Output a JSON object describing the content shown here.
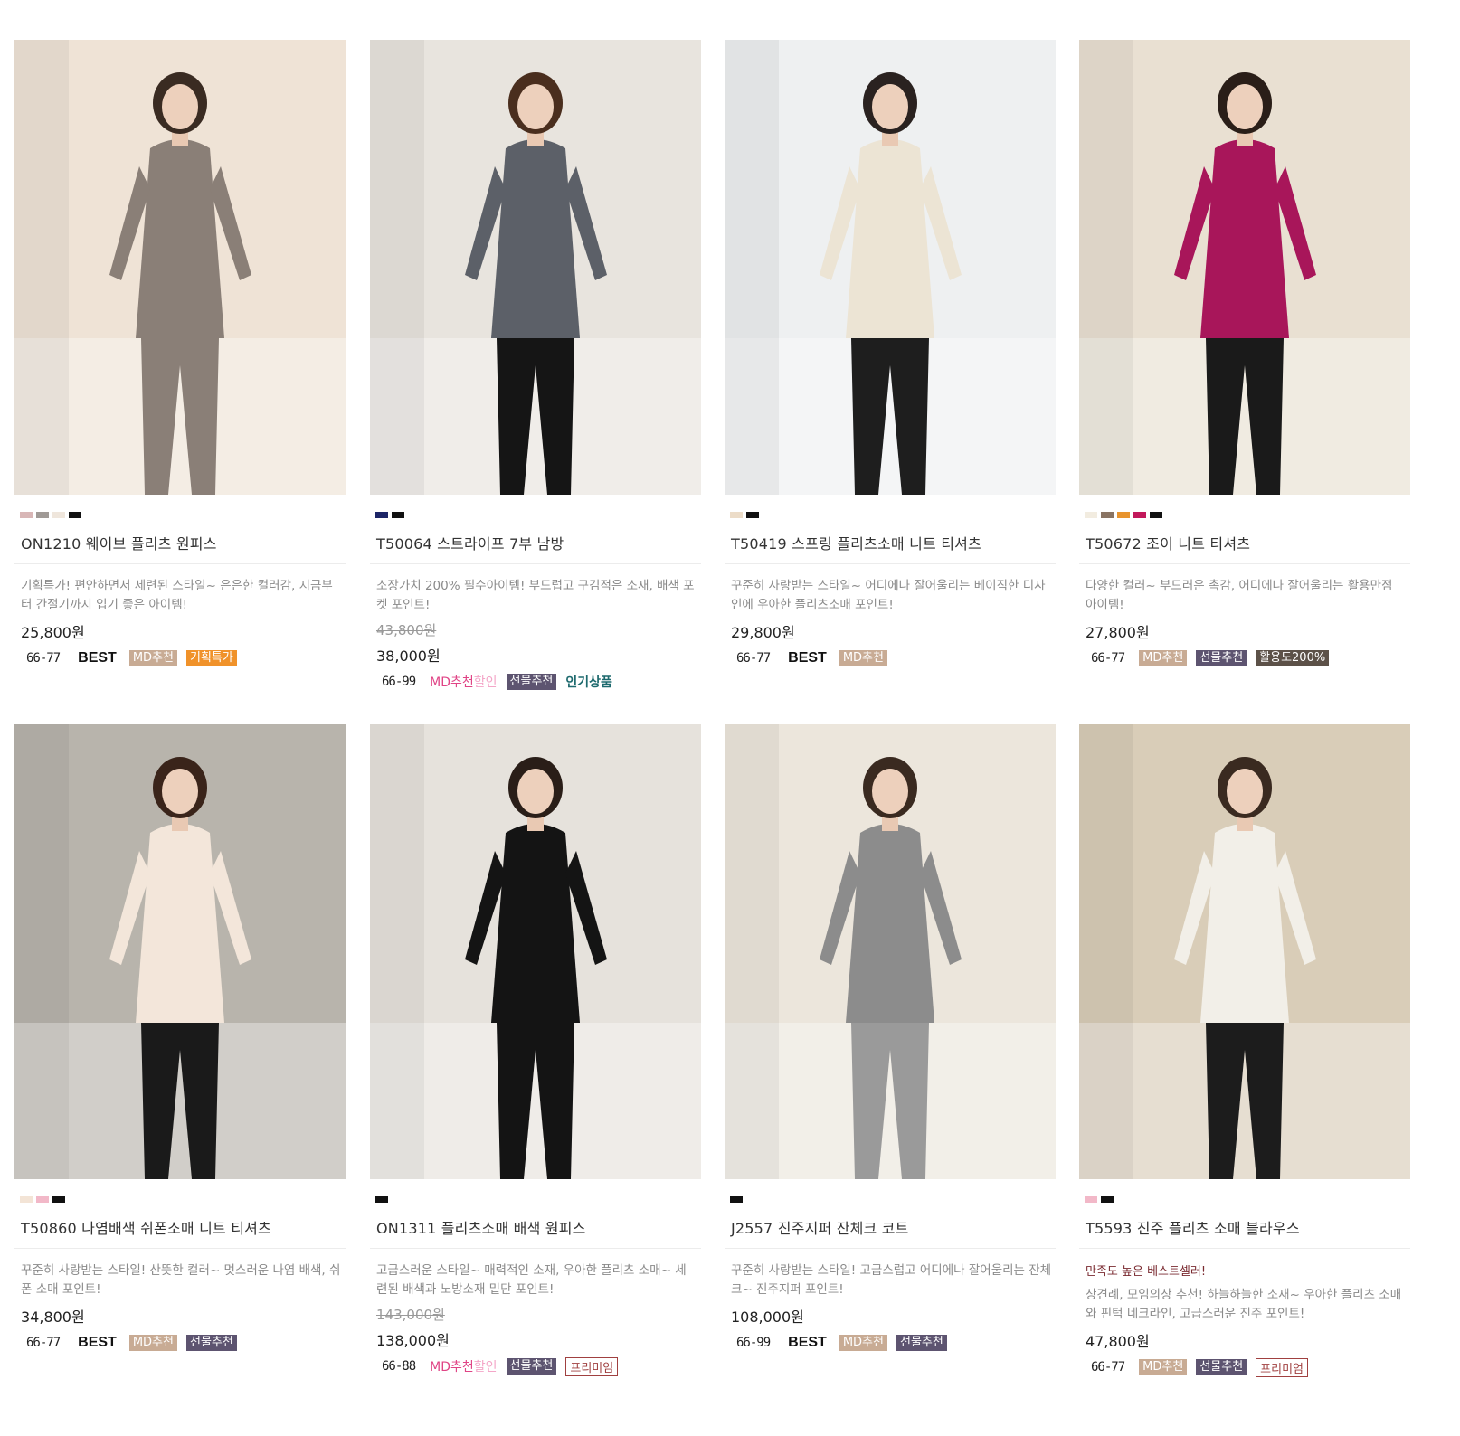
{
  "products": [
    {
      "swatches": [
        "#d8b6b6",
        "#a09a96",
        "#efe6dc",
        "#111111"
      ],
      "title": "ON1210 웨이브 플리츠 원피스",
      "description": "기획특가! 편안하면서 세련된 스타일~ 은은한 컬러감, 지금부터 간절기까지 입기 좋은 아이템!",
      "original_price": "",
      "price": "25,800원",
      "size": "66-77",
      "best": "BEST",
      "badges": [
        "MD추천",
        "기획특가"
      ],
      "image": {
        "bg": "#efe3d6",
        "top": "#8a7f77",
        "bottom": "#8a7f77",
        "hair": "#3a2b22"
      }
    },
    {
      "swatches": [
        "#1d2567",
        "#111111"
      ],
      "title": "T50064 스트라이프 7부 남방",
      "description": "소장가치 200% 필수아이템! 부드럽고 구김적은 소재, 배색 포켓 포인트!",
      "original_price": "43,800원",
      "price": "38,000원",
      "size": "66-99",
      "md_sale": {
        "md": "MD추천",
        "sale": "할인"
      },
      "badges": [
        "선물추천",
        "인기상품"
      ],
      "image": {
        "bg": "#e8e4de",
        "top": "#5c6068",
        "bottom": "#151515",
        "hair": "#4a2e1e"
      }
    },
    {
      "swatches": [
        "#ecdcc8",
        "#111111"
      ],
      "title": "T50419 스프링 플리츠소매 니트 티셔츠",
      "description": "꾸준히 사랑받는 스타일~ 어디에나 잘어울리는 베이직한 디자인에 우아한 플리츠소매 포인트!",
      "original_price": "",
      "price": "29,800원",
      "size": "66-77",
      "best": "BEST",
      "badges": [
        "MD추천"
      ],
      "image": {
        "bg": "#eef0f1",
        "top": "#ece4d4",
        "bottom": "#1e1e1e",
        "hair": "#2a2220"
      }
    },
    {
      "swatches": [
        "#f2ece0",
        "#8a7463",
        "#e8942e",
        "#c2185b",
        "#111111"
      ],
      "title": "T50672 조이 니트 티셔츠",
      "description": "다양한 컬러~ 부드러운 촉감, 어디에나 잘어울리는 활용만점 아이템!",
      "original_price": "",
      "price": "27,800원",
      "size": "66-77",
      "badges": [
        "MD추천",
        "선물추천",
        "활용도200%"
      ],
      "image": {
        "bg": "#e9e0d2",
        "top": "#a8165a",
        "bottom": "#1a1a1a",
        "hair": "#2a1e18"
      }
    },
    {
      "swatches": [
        "#f3e4d6",
        "#f2b8c8",
        "#111111"
      ],
      "title": "T50860 나염배색 쉬폰소매 니트 티셔츠",
      "description": "꾸준히 사랑받는 스타일! 산뜻한 컬러~ 멋스러운 나염 배색, 쉬폰 소매 포인트!",
      "original_price": "",
      "price": "34,800원",
      "size": "66-77",
      "best": "BEST",
      "badges": [
        "MD추천",
        "선물추천"
      ],
      "image": {
        "bg": "#b8b4ac",
        "top": "#f3e6da",
        "bottom": "#1a1a1a",
        "hair": "#3a241a"
      }
    },
    {
      "swatches": [
        "#111111"
      ],
      "title": "ON1311 플리츠소매 배색 원피스",
      "description": "고급스러운 스타일~ 매력적인 소재, 우아한 플리츠 소매~ 세련된 배색과 노방소재 밑단 포인트!",
      "original_price": "143,000원",
      "price": "138,000원",
      "size": "66-88",
      "md_sale": {
        "md": "MD추천",
        "sale": "할인"
      },
      "badges": [
        "선물추천",
        "프리미엄"
      ],
      "image": {
        "bg": "#e6e2dc",
        "top": "#141414",
        "bottom": "#141414",
        "hair": "#2a1e18"
      }
    },
    {
      "swatches": [
        "#111111"
      ],
      "title": "J2557 진주지퍼 잔체크 코트",
      "description": "꾸준히 사랑받는 스타일! 고급스럽고 어디에나 잘어울리는 잔체크~ 진주지퍼 포인트!",
      "original_price": "",
      "price": "108,000원",
      "size": "66-99",
      "best": "BEST",
      "badges": [
        "MD추천",
        "선물추천"
      ],
      "image": {
        "bg": "#ece6dc",
        "top": "#8c8c8c",
        "bottom": "#9a9a9a",
        "hair": "#3a2a20"
      }
    },
    {
      "swatches": [
        "#f2b8c8",
        "#111111"
      ],
      "title": "T5593 진주 플리츠 소매 블라우스",
      "tagline": "만족도 높은 베스트셀러!",
      "description": "상견례, 모임의상 추천! 하늘하늘한 소재~ 우아한 플리츠 소매와 핀턱 네크라인, 고급스러운 진주 포인트!",
      "original_price": "",
      "price": "47,800원",
      "size": "66-77",
      "badges": [
        "MD추천",
        "선물추천",
        "프리미엄"
      ],
      "image": {
        "bg": "#d9cdb8",
        "top": "#f2efe8",
        "bottom": "#1c1c1c",
        "hair": "#3a2a20"
      }
    }
  ]
}
